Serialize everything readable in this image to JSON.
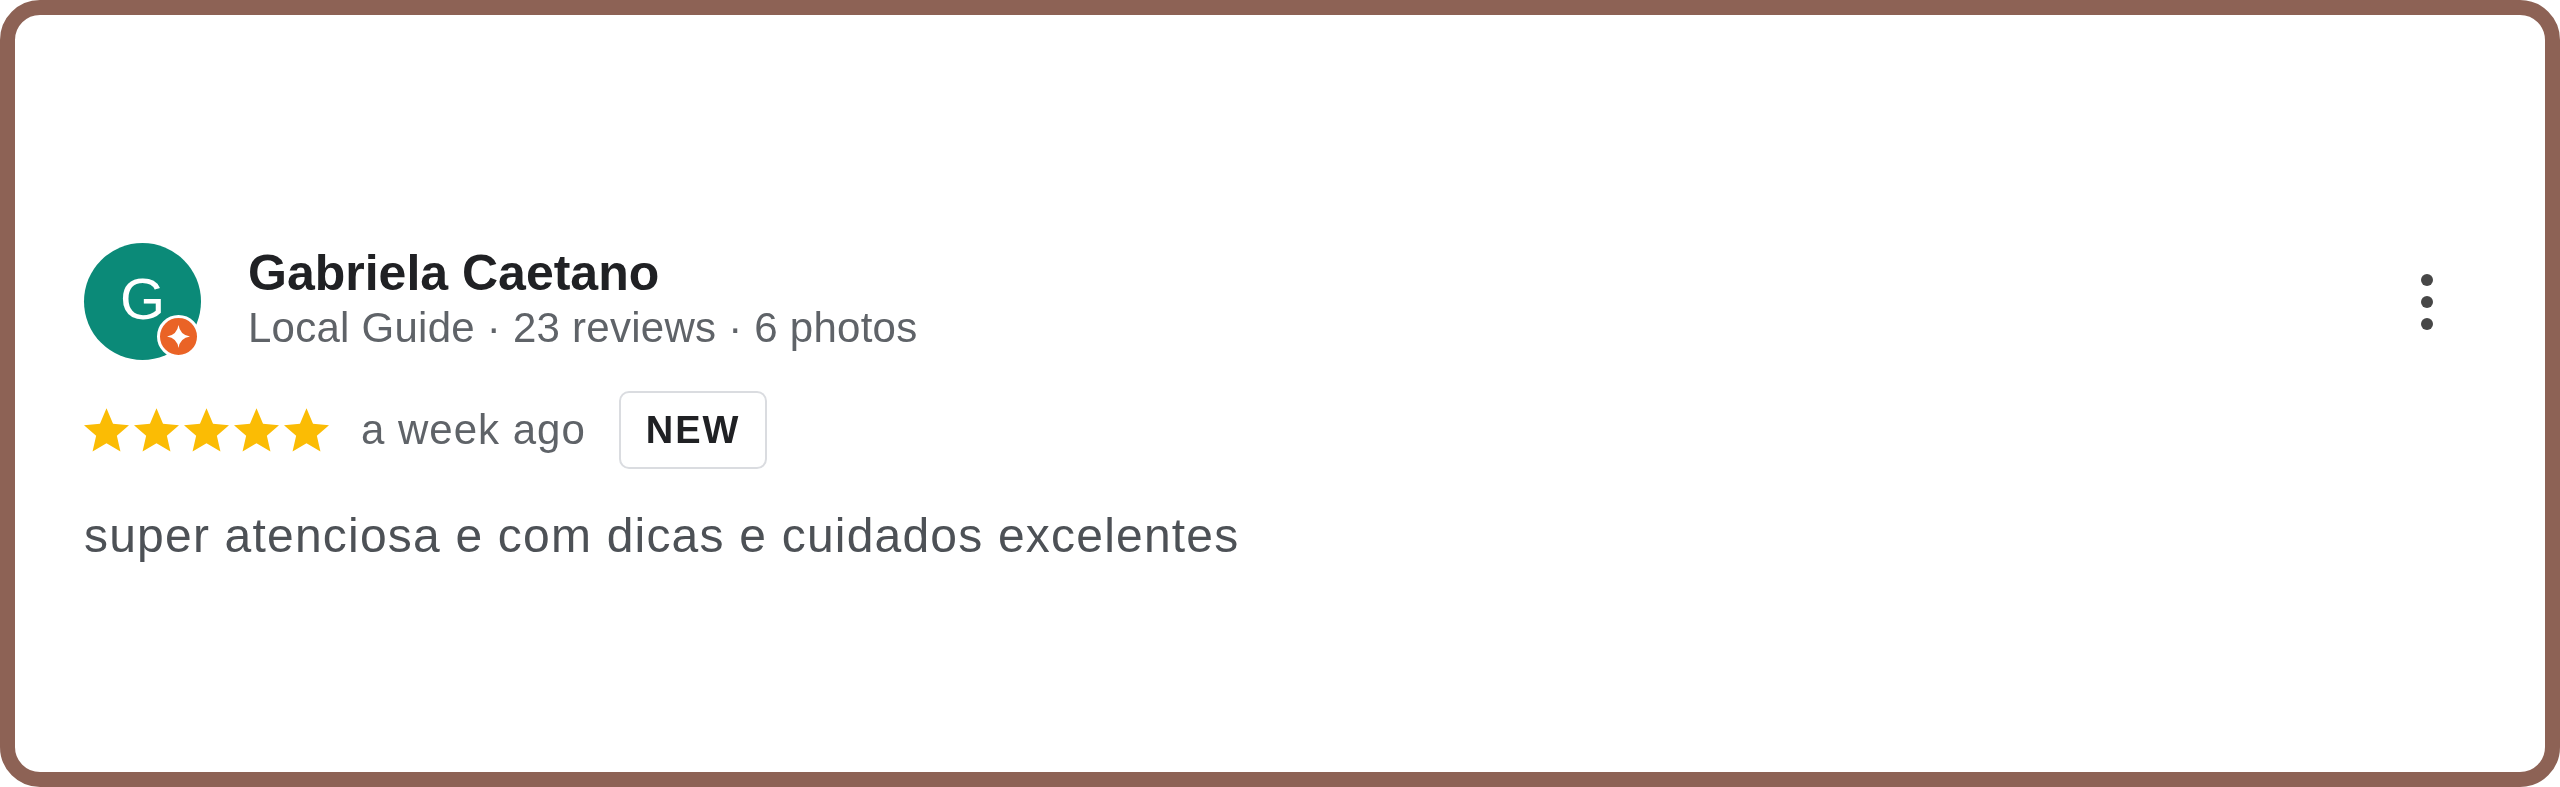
{
  "review": {
    "author": {
      "avatar_letter": "G",
      "name": "Gabriela Caetano",
      "local_guide": true,
      "subtitle": "Local Guide · 23 reviews · 6 photos"
    },
    "stars": 5,
    "time": "a week ago",
    "badge": "NEW",
    "text": "super atenciosa e com dicas e cuidados excelentes"
  }
}
